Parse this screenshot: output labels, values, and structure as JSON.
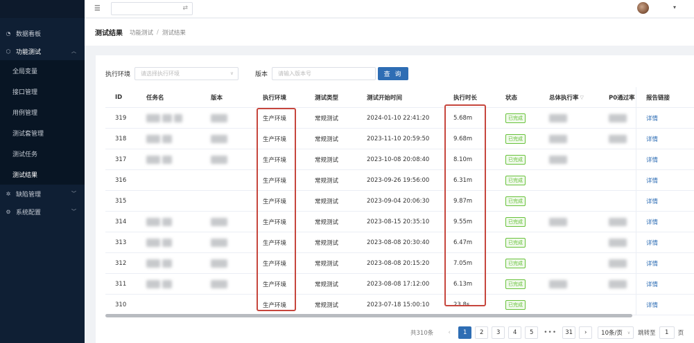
{
  "sidebar": {
    "items": [
      {
        "label": "数据看板",
        "icon": "dashboard-icon"
      },
      {
        "label": "功能测试",
        "icon": "cube-icon",
        "open": true,
        "children": [
          "全局变量",
          "接口管理",
          "用例管理",
          "测试套管理",
          "测试任务",
          "测试结果"
        ],
        "active_child": "测试结果"
      },
      {
        "label": "缺陷管理",
        "icon": "bug-icon"
      },
      {
        "label": "系统配置",
        "icon": "gear-icon"
      }
    ]
  },
  "header": {
    "menu_icon": "hamburger-icon",
    "swap_icon": "swap-icon",
    "caret": "▾"
  },
  "breadcrumb": {
    "title": "测试结果",
    "path": [
      "功能测试",
      "测试结果"
    ],
    "separator": "/"
  },
  "filter": {
    "env_label": "执行环境",
    "env_placeholder": "请选择执行环境",
    "version_label": "版本",
    "version_placeholder": "请输入版本号",
    "query_button": "查 询"
  },
  "table": {
    "columns": [
      "ID",
      "任务名",
      "版本",
      "执行环境",
      "测试类型",
      "测试开始时间",
      "执行时长",
      "状态",
      "总体执行率",
      "P0通过率",
      "报告链接"
    ],
    "status_label": "已完成",
    "link_label": "详情",
    "rows": [
      {
        "id": "319",
        "env": "生产环境",
        "type": "常规测试",
        "start": "2024-01-10 22:41:20",
        "duration": "5.68m"
      },
      {
        "id": "318",
        "env": "生产环境",
        "type": "常规测试",
        "start": "2023-11-10 20:59:50",
        "duration": "9.68m"
      },
      {
        "id": "317",
        "env": "生产环境",
        "type": "常规测试",
        "start": "2023-10-08 20:08:40",
        "duration": "8.10m"
      },
      {
        "id": "316",
        "env": "生产环境",
        "type": "常规测试",
        "start": "2023-09-26 19:56:00",
        "duration": "6.31m"
      },
      {
        "id": "315",
        "env": "生产环境",
        "type": "常规测试",
        "start": "2023-09-04 20:06:30",
        "duration": "9.87m"
      },
      {
        "id": "314",
        "env": "生产环境",
        "type": "常规测试",
        "start": "2023-08-15 20:35:10",
        "duration": "9.55m"
      },
      {
        "id": "313",
        "env": "生产环境",
        "type": "常规测试",
        "start": "2023-08-08 20:30:40",
        "duration": "6.47m"
      },
      {
        "id": "312",
        "env": "生产环境",
        "type": "常规测试",
        "start": "2023-08-08 20:15:20",
        "duration": "7.05m"
      },
      {
        "id": "311",
        "env": "生产环境",
        "type": "常规测试",
        "start": "2023-08-08 17:12:00",
        "duration": "6.13m"
      },
      {
        "id": "310",
        "env": "生产环境",
        "type": "常规测试",
        "start": "2023-07-18 15:00:10",
        "duration": "23.8s"
      }
    ]
  },
  "pagination": {
    "total": "共310条",
    "prev": "‹",
    "next": "›",
    "pages": [
      "1",
      "2",
      "3",
      "4",
      "5"
    ],
    "current": "1",
    "ellipsis": "•••",
    "last": "31",
    "page_size": "10条/页",
    "jump_label": "跳转至",
    "jump_value": "1",
    "page_unit": "页"
  },
  "colors": {
    "sidebar_bg": "#0f1f34",
    "primary": "#2e6db4",
    "success": "#67c23a",
    "highlight_box": "#c6453c"
  }
}
